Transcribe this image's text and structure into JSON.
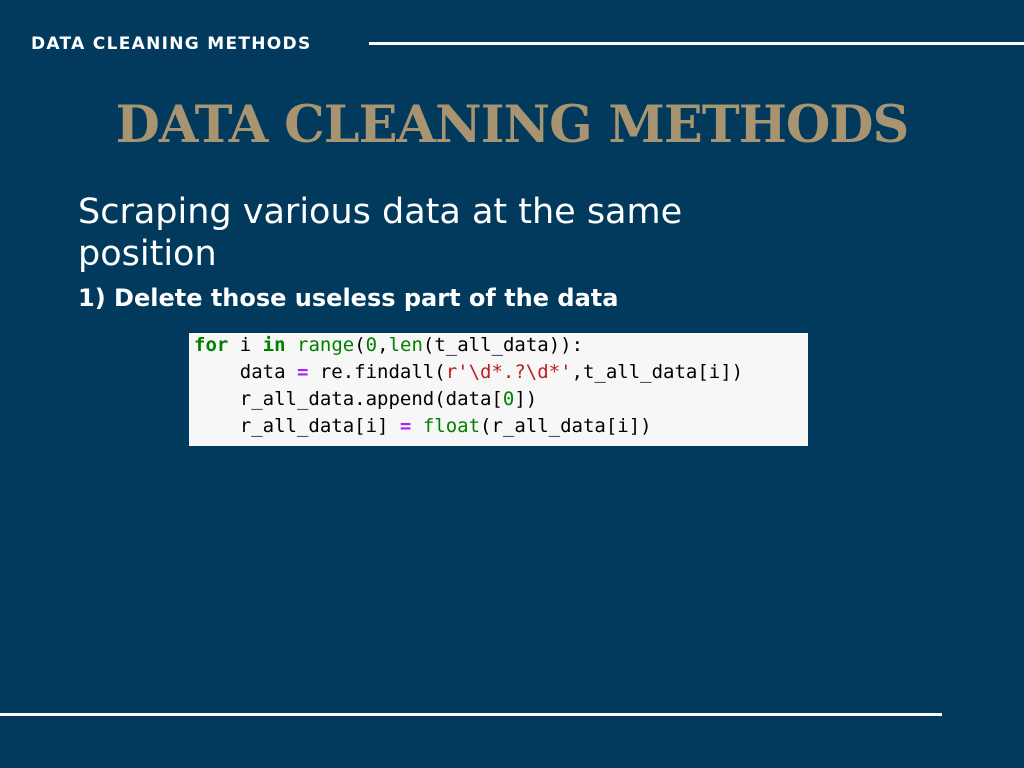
{
  "header": {
    "label": "DATA CLEANING METHODS"
  },
  "slide": {
    "title": "DATA CLEANING METHODS",
    "subtitle": "Scraping various data at the same position",
    "step": "1) Delete those useless part of the data"
  },
  "code": {
    "lines": [
      [
        {
          "t": "for",
          "k": "kw"
        },
        {
          "t": " i ",
          "k": "plain"
        },
        {
          "t": "in",
          "k": "kw"
        },
        {
          "t": " ",
          "k": "plain"
        },
        {
          "t": "range",
          "k": "bi"
        },
        {
          "t": "(",
          "k": "plain"
        },
        {
          "t": "0",
          "k": "num"
        },
        {
          "t": ",",
          "k": "plain"
        },
        {
          "t": "len",
          "k": "bi"
        },
        {
          "t": "(t_all_data)):",
          "k": "plain"
        }
      ],
      [
        {
          "t": "    data ",
          "k": "plain"
        },
        {
          "t": "=",
          "k": "op"
        },
        {
          "t": " re.findall(",
          "k": "plain"
        },
        {
          "t": "r'\\d*.?\\d*'",
          "k": "str"
        },
        {
          "t": ",t_all_data[i])",
          "k": "plain"
        }
      ],
      [
        {
          "t": "    r_all_data.append(data[",
          "k": "plain"
        },
        {
          "t": "0",
          "k": "num"
        },
        {
          "t": "])",
          "k": "plain"
        }
      ],
      [
        {
          "t": "    r_all_data[i] ",
          "k": "plain"
        },
        {
          "t": "=",
          "k": "op"
        },
        {
          "t": " ",
          "k": "plain"
        },
        {
          "t": "float",
          "k": "bi"
        },
        {
          "t": "(r_all_data[i])",
          "k": "plain"
        }
      ]
    ]
  },
  "colors": {
    "background": "#013a5c",
    "title": "#a89470",
    "text": "#ffffff",
    "code_background": "#f7f7f7",
    "code_keyword": "#008000",
    "code_string": "#ba2121",
    "code_operator": "#aa22ff"
  }
}
